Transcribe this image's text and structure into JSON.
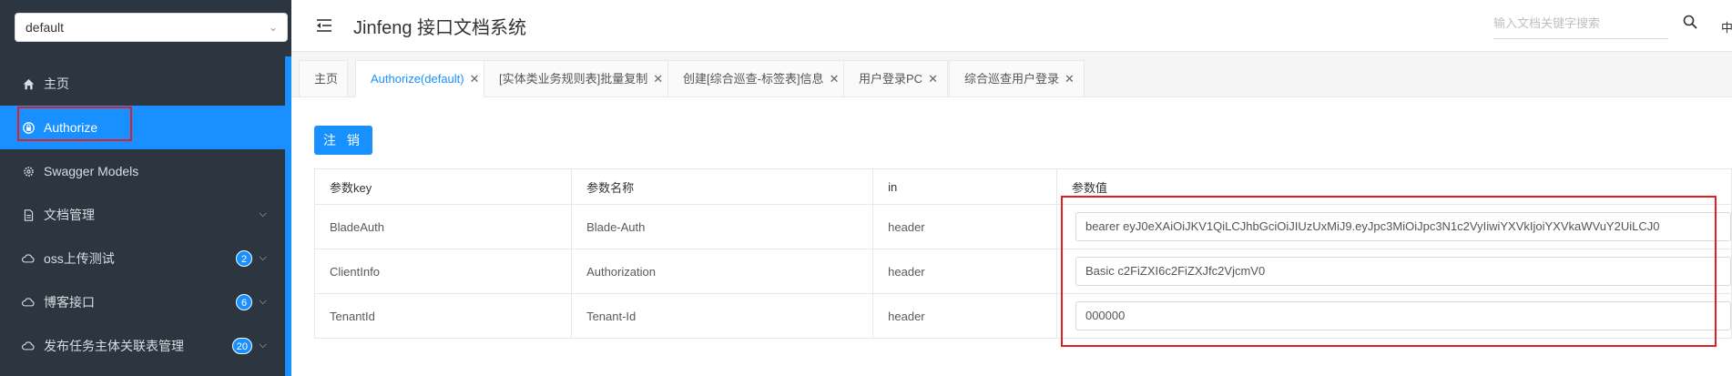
{
  "sidebar": {
    "group_select": "default",
    "items": [
      {
        "label": "主页",
        "icon": "home-icon",
        "badge": null,
        "arrow": false,
        "active": false
      },
      {
        "label": "Authorize",
        "icon": "lock-icon",
        "badge": null,
        "arrow": false,
        "active": true
      },
      {
        "label": "Swagger Models",
        "icon": "gear-icon",
        "badge": null,
        "arrow": false,
        "active": false
      },
      {
        "label": "文档管理",
        "icon": "document-icon",
        "badge": null,
        "arrow": true,
        "active": false
      },
      {
        "label": "oss上传测试",
        "icon": "cloud-icon",
        "badge": "2",
        "arrow": true,
        "active": false
      },
      {
        "label": "博客接口",
        "icon": "cloud-icon",
        "badge": "6",
        "arrow": true,
        "active": false
      },
      {
        "label": "发布任务主体关联表管理",
        "icon": "cloud-icon",
        "badge": "20",
        "arrow": true,
        "active": false
      }
    ]
  },
  "header": {
    "title": "Jinfeng 接口文档系统",
    "search_placeholder": "输入文档关键字搜索",
    "lang": "中"
  },
  "tabs": [
    {
      "label": "主页",
      "closable": false,
      "active": false
    },
    {
      "label": "Authorize(default)",
      "closable": true,
      "active": true
    },
    {
      "label": "[实体类业务规则表]批量复制",
      "closable": true,
      "active": false
    },
    {
      "label": "创建[综合巡查-标签表]信息",
      "closable": true,
      "active": false
    },
    {
      "label": "用户登录PC",
      "closable": true,
      "active": false
    },
    {
      "label": "综合巡查用户登录",
      "closable": true,
      "active": false
    }
  ],
  "content": {
    "logout_label": "注 销",
    "table": {
      "headers": [
        "参数key",
        "参数名称",
        "in",
        "参数值"
      ],
      "rows": [
        {
          "key": "BladeAuth",
          "name": "Blade-Auth",
          "in": "header",
          "value": "bearer eyJ0eXAiOiJKV1QiLCJhbGciOiJIUzUxMiJ9.eyJpc3MiOiJpc3N1c2VyIiwiYXVkIjoiYXVkaWVuY2UiLCJ0"
        },
        {
          "key": "ClientInfo",
          "name": "Authorization",
          "in": "header",
          "value": "Basic c2FiZXI6c2FiZXJfc2VjcmV0"
        },
        {
          "key": "TenantId",
          "name": "Tenant-Id",
          "in": "header",
          "value": "000000"
        }
      ]
    }
  },
  "colors": {
    "sidebar_bg": "#2b3641",
    "accent": "#1890ff",
    "highlight_border": "#e02020"
  }
}
